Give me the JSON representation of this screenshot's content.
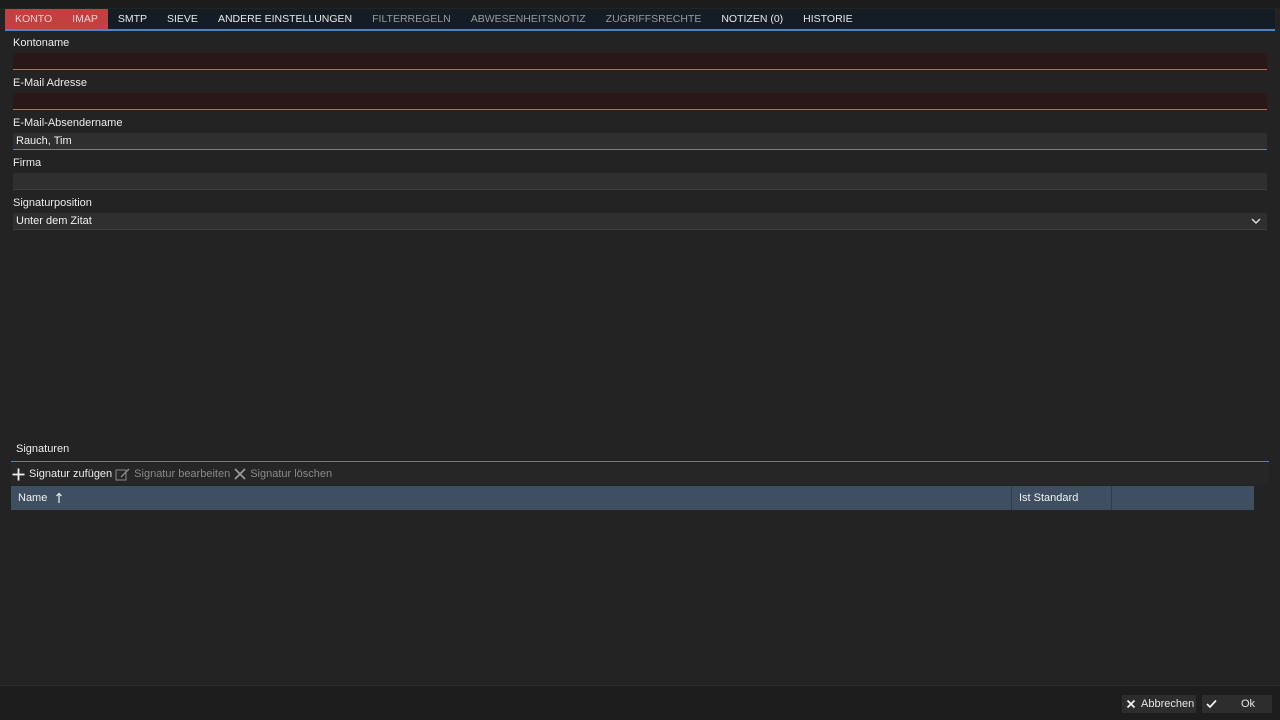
{
  "tabs": [
    {
      "label": "KONTO",
      "state": "error"
    },
    {
      "label": "IMAP",
      "state": "error"
    },
    {
      "label": "SMTP",
      "state": "normal"
    },
    {
      "label": "SIEVE",
      "state": "normal"
    },
    {
      "label": "ANDERE EINSTELLUNGEN",
      "state": "normal"
    },
    {
      "label": "FILTERREGELN",
      "state": "dim"
    },
    {
      "label": "ABWESENHEITSNOTIZ",
      "state": "dim"
    },
    {
      "label": "ZUGRIFFSRECHTE",
      "state": "dim"
    },
    {
      "label": "NOTIZEN (0)",
      "state": "normal"
    },
    {
      "label": "HISTORIE",
      "state": "normal"
    }
  ],
  "form": {
    "account_name": {
      "label": "Kontoname",
      "value": ""
    },
    "email": {
      "label": "E-Mail Adresse",
      "value": ""
    },
    "sender_name": {
      "label": "E-Mail-Absendername",
      "value": "Rauch, Tim"
    },
    "company": {
      "label": "Firma",
      "value": ""
    },
    "signature_position": {
      "label": "Signaturposition",
      "value": "Unter dem Zitat"
    }
  },
  "signatures": {
    "title": "Signaturen",
    "add_label": "Signatur zufügen",
    "edit_label": "Signatur bearbeiten",
    "delete_label": "Signatur löschen",
    "columns": {
      "name": "Name",
      "is_default": "Ist Standard"
    }
  },
  "footer": {
    "cancel_label": "Abbrechen",
    "ok_label": "Ok"
  },
  "colors": {
    "accent": "#4a86c4",
    "error_tab": "#c44040",
    "invalid_border": "#d85c5c",
    "background": "#232323",
    "grid_header": "#3d4f60"
  }
}
